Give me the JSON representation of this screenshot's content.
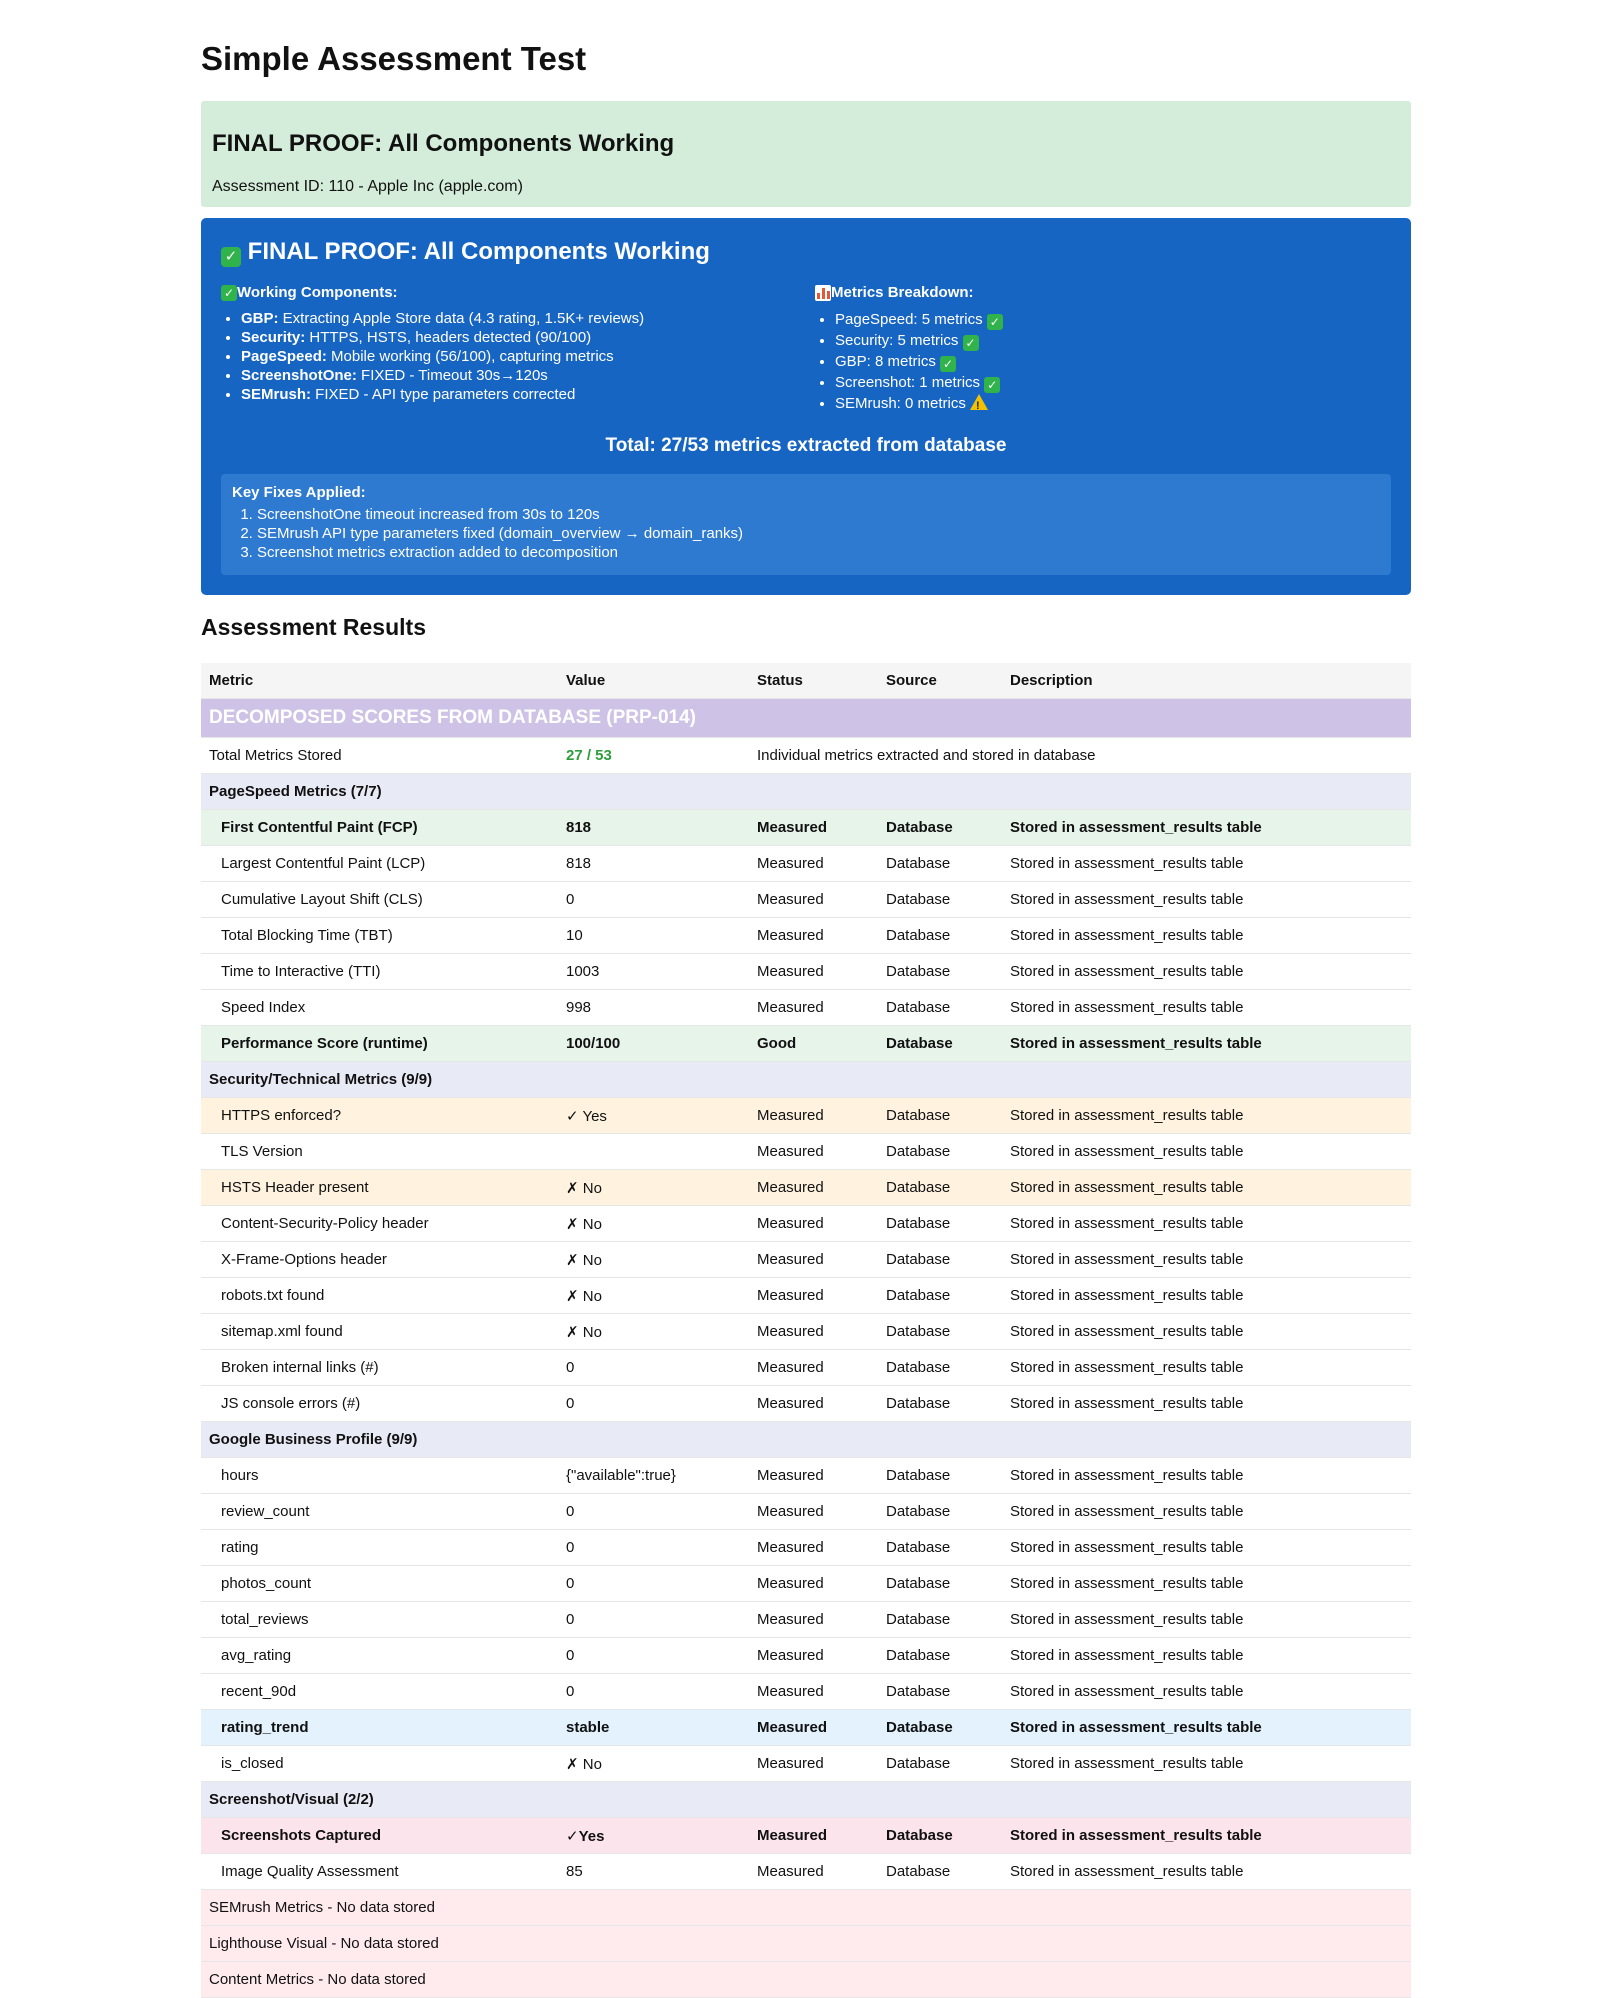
{
  "page": {
    "title": "Simple Assessment Test"
  },
  "proof_light": {
    "title": "FINAL PROOF: All Components Working",
    "assessment_id": "Assessment ID: 110 - Apple Inc (apple.com)"
  },
  "proof_blue": {
    "title": "FINAL PROOF: All Components Working",
    "working_title": "Working Components:",
    "working": [
      {
        "name": "GBP:",
        "text": " Extracting Apple Store data (4.3 rating, 1.5K+ reviews)"
      },
      {
        "name": "Security:",
        "text": " HTTPS, HSTS, headers detected (90/100)"
      },
      {
        "name": "PageSpeed:",
        "text": " Mobile working (56/100), capturing metrics"
      },
      {
        "name": "ScreenshotOne:",
        "text": " FIXED - Timeout 30s→120s"
      },
      {
        "name": "SEMrush:",
        "text": " FIXED - API type parameters corrected"
      }
    ],
    "metrics_title": "Metrics Breakdown:",
    "metrics": [
      {
        "text": "PageSpeed: 5 metrics ",
        "icon": "check"
      },
      {
        "text": "Security: 5 metrics ",
        "icon": "check"
      },
      {
        "text": "GBP: 8 metrics ",
        "icon": "check"
      },
      {
        "text": "Screenshot: 1 metrics ",
        "icon": "check"
      },
      {
        "text": "SEMrush: 0 metrics ",
        "icon": "warning"
      }
    ],
    "total": "Total: 27/53 metrics extracted from database",
    "fixes_title": "Key Fixes Applied:",
    "fixes": [
      "ScreenshotOne timeout increased from 30s to 120s",
      "SEMrush API type parameters fixed (domain_overview → domain_ranks)",
      "Screenshot metrics extraction added to decomposition"
    ]
  },
  "results": {
    "heading": "Assessment Results",
    "columns": [
      "Metric",
      "Value",
      "Status",
      "Source",
      "Description"
    ],
    "decomposed_title": "DECOMPOSED SCORES FROM DATABASE (PRP-014)",
    "total_row": {
      "metric": "Total Metrics Stored",
      "value": "27 / 53",
      "description": "Individual metrics extracted and stored in database"
    },
    "sections": [
      {
        "title": "PageSpeed Metrics (7/7)",
        "rows": [
          {
            "metric": "First Contentful Paint (FCP)",
            "value": "818",
            "status": "Measured",
            "source": "Database",
            "description": "Stored in assessment_results table",
            "style": "hl-green"
          },
          {
            "metric": "Largest Contentful Paint (LCP)",
            "value": "818",
            "status": "Measured",
            "source": "Database",
            "description": "Stored in assessment_results table",
            "style": ""
          },
          {
            "metric": "Cumulative Layout Shift (CLS)",
            "value": "0",
            "status": "Measured",
            "source": "Database",
            "description": "Stored in assessment_results table",
            "style": ""
          },
          {
            "metric": "Total Blocking Time (TBT)",
            "value": "10",
            "status": "Measured",
            "source": "Database",
            "description": "Stored in assessment_results table",
            "style": ""
          },
          {
            "metric": "Time to Interactive (TTI)",
            "value": "1003",
            "status": "Measured",
            "source": "Database",
            "description": "Stored in assessment_results table",
            "style": ""
          },
          {
            "metric": "Speed Index",
            "value": "998",
            "status": "Measured",
            "source": "Database",
            "description": "Stored in assessment_results table",
            "style": ""
          },
          {
            "metric": "Performance Score (runtime)",
            "value": "100/100",
            "status": "Good",
            "source": "Database",
            "description": "Stored in assessment_results table",
            "style": "hl-green"
          }
        ]
      },
      {
        "title": "Security/Technical Metrics (9/9)",
        "rows": [
          {
            "metric": "HTTPS enforced?",
            "value": "✓ Yes",
            "status": "Measured",
            "source": "Database",
            "description": "Stored in assessment_results table",
            "style": "hl-orange"
          },
          {
            "metric": "TLS Version",
            "value": "",
            "status": "Measured",
            "source": "Database",
            "description": "Stored in assessment_results table",
            "style": ""
          },
          {
            "metric": "HSTS Header present",
            "value": "✗ No",
            "status": "Measured",
            "source": "Database",
            "description": "Stored in assessment_results table",
            "style": "hl-orange"
          },
          {
            "metric": "Content-Security-Policy header",
            "value": "✗ No",
            "status": "Measured",
            "source": "Database",
            "description": "Stored in assessment_results table",
            "style": ""
          },
          {
            "metric": "X-Frame-Options header",
            "value": "✗ No",
            "status": "Measured",
            "source": "Database",
            "description": "Stored in assessment_results table",
            "style": ""
          },
          {
            "metric": "robots.txt found",
            "value": "✗ No",
            "status": "Measured",
            "source": "Database",
            "description": "Stored in assessment_results table",
            "style": ""
          },
          {
            "metric": "sitemap.xml found",
            "value": "✗ No",
            "status": "Measured",
            "source": "Database",
            "description": "Stored in assessment_results table",
            "style": ""
          },
          {
            "metric": "Broken internal links (#)",
            "value": "0",
            "status": "Measured",
            "source": "Database",
            "description": "Stored in assessment_results table",
            "style": ""
          },
          {
            "metric": "JS console errors (#)",
            "value": "0",
            "status": "Measured",
            "source": "Database",
            "description": "Stored in assessment_results table",
            "style": ""
          }
        ]
      },
      {
        "title": "Google Business Profile (9/9)",
        "rows": [
          {
            "metric": "hours",
            "value": "{\"available\":true}",
            "status": "Measured",
            "source": "Database",
            "description": "Stored in assessment_results table",
            "style": ""
          },
          {
            "metric": "review_count",
            "value": "0",
            "status": "Measured",
            "source": "Database",
            "description": "Stored in assessment_results table",
            "style": ""
          },
          {
            "metric": "rating",
            "value": "0",
            "status": "Measured",
            "source": "Database",
            "description": "Stored in assessment_results table",
            "style": ""
          },
          {
            "metric": "photos_count",
            "value": "0",
            "status": "Measured",
            "source": "Database",
            "description": "Stored in assessment_results table",
            "style": ""
          },
          {
            "metric": "total_reviews",
            "value": "0",
            "status": "Measured",
            "source": "Database",
            "description": "Stored in assessment_results table",
            "style": ""
          },
          {
            "metric": "avg_rating",
            "value": "0",
            "status": "Measured",
            "source": "Database",
            "description": "Stored in assessment_results table",
            "style": ""
          },
          {
            "metric": "recent_90d",
            "value": "0",
            "status": "Measured",
            "source": "Database",
            "description": "Stored in assessment_results table",
            "style": ""
          },
          {
            "metric": "rating_trend",
            "value": "stable",
            "status": "Measured",
            "source": "Database",
            "description": "Stored in assessment_results table",
            "style": "hl-blue"
          },
          {
            "metric": "is_closed",
            "value": "✗ No",
            "status": "Measured",
            "source": "Database",
            "description": "Stored in assessment_results table",
            "style": ""
          }
        ]
      },
      {
        "title": "Screenshot/Visual (2/2)",
        "rows": [
          {
            "metric": "Screenshots Captured",
            "value": "✓Yes",
            "status": "Measured",
            "source": "Database",
            "description": "Stored in assessment_results table",
            "style": "hl-pink"
          },
          {
            "metric": "Image Quality Assessment",
            "value": "85",
            "status": "Measured",
            "source": "Database",
            "description": "Stored in assessment_results table",
            "style": ""
          }
        ]
      }
    ],
    "no_data": [
      "SEMrush Metrics - No data stored",
      "Lighthouse Visual - No data stored",
      "Content Metrics - No data stored"
    ]
  },
  "colors": {
    "proof_light_bg": "#d4edda",
    "proof_blue_bg": "#1765c3",
    "decomposed_bg": "#cec3e6",
    "category_bg": "#e8eaf6",
    "highlight_green": "#e6f4ea",
    "highlight_orange": "#fff3e0",
    "highlight_blue": "#e3f2fd",
    "highlight_pink": "#fce4ec",
    "no_data_bg": "#ffebee",
    "total_value_color": "#2e9e3c"
  }
}
